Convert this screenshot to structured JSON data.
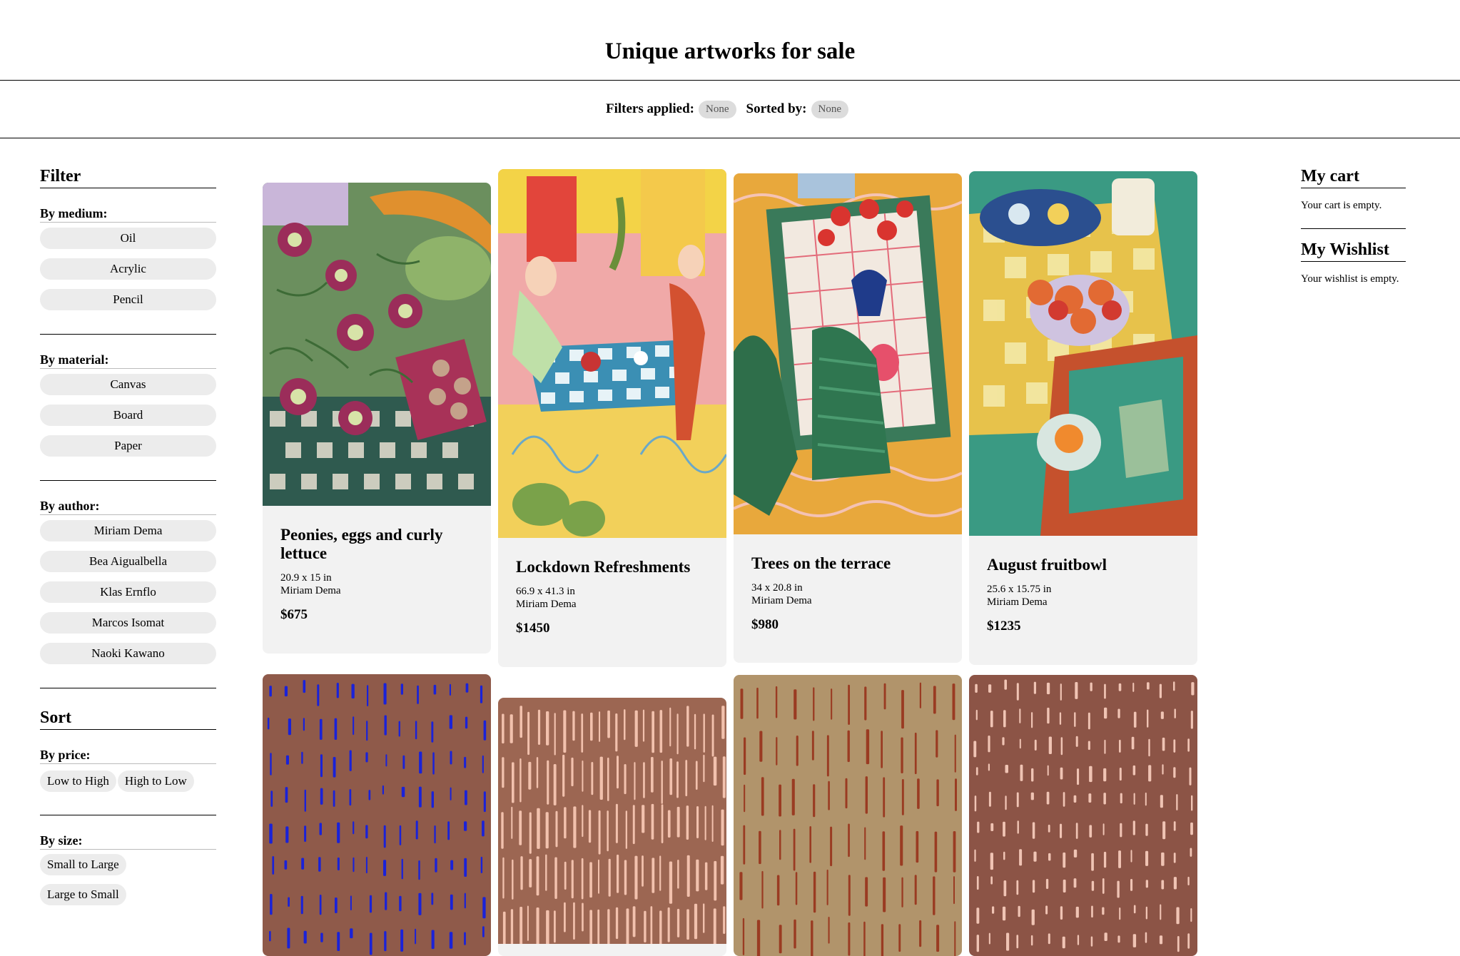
{
  "page": {
    "title": "Unique artworks for sale"
  },
  "status": {
    "filters_label": "Filters applied:",
    "filters_value": "None",
    "sorted_label": "Sorted by:",
    "sorted_value": "None"
  },
  "filter": {
    "title": "Filter",
    "medium_label": "By medium:",
    "medium": [
      "Oil",
      "Acrylic",
      "Pencil"
    ],
    "material_label": "By material:",
    "material": [
      "Canvas",
      "Board",
      "Paper"
    ],
    "author_label": "By author:",
    "author": [
      "Miriam Dema",
      "Bea Aigualbella",
      "Klas Ernflo",
      "Marcos Isomat",
      "Naoki Kawano"
    ]
  },
  "sort": {
    "title": "Sort",
    "price_label": "By price:",
    "price": [
      "Low to High",
      "High to Low"
    ],
    "size_label": "By size:",
    "size": [
      "Small to Large",
      "Large to Small"
    ]
  },
  "cart": {
    "title": "My cart",
    "empty": "Your cart is empty."
  },
  "wishlist": {
    "title": "My Wishlist",
    "empty": "Your wishlist is empty."
  },
  "products": [
    {
      "title": "Peonies, eggs and curly lettuce",
      "dims": "20.9 x 15 in",
      "author": "Miriam Dema",
      "price": "$675"
    },
    {
      "title": "Lockdown Refreshments",
      "dims": "66.9 x 41.3 in",
      "author": "Miriam Dema",
      "price": "$1450"
    },
    {
      "title": "Trees on the terrace",
      "dims": "34 x 20.8 in",
      "author": "Miriam Dema",
      "price": "$980"
    },
    {
      "title": "August fruitbowl",
      "dims": "25.6 x 15.75 in",
      "author": "Miriam Dema",
      "price": "$1235"
    }
  ],
  "colors": {
    "chip_bg": "#ececec",
    "card_bg": "#f2f2f2",
    "pill_bg": "#dcdcdc"
  }
}
